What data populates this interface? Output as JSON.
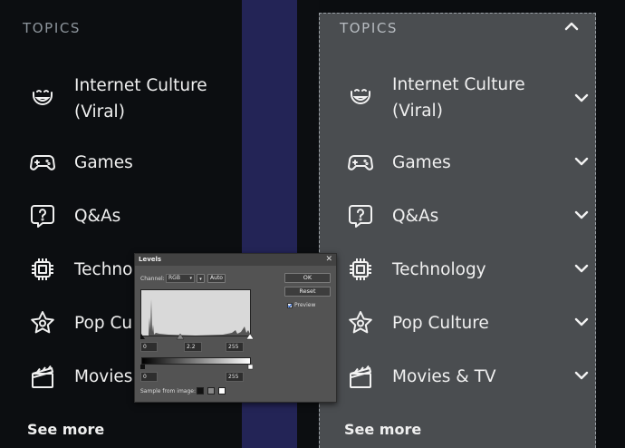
{
  "left_panel": {
    "title": "TOPICS",
    "items": [
      {
        "label_line1": "Internet Culture",
        "label_line2": "(Viral)",
        "icon": "smile-icon"
      },
      {
        "label": "Games",
        "icon": "gamepad-icon"
      },
      {
        "label": "Q&As",
        "icon": "question-bubble-icon"
      },
      {
        "label": "Techno",
        "icon": "chip-icon"
      },
      {
        "label": "Pop Cu",
        "icon": "star-icon"
      },
      {
        "label": "Movies",
        "icon": "clapperboard-icon"
      }
    ],
    "see_more": "See more"
  },
  "right_panel": {
    "title": "TOPICS",
    "items": [
      {
        "label_line1": "Internet Culture",
        "label_line2": "(Viral)",
        "icon": "smile-icon"
      },
      {
        "label": "Games",
        "icon": "gamepad-icon"
      },
      {
        "label": "Q&As",
        "icon": "question-bubble-icon"
      },
      {
        "label": "Technology",
        "icon": "chip-icon"
      },
      {
        "label": "Pop Culture",
        "icon": "star-icon"
      },
      {
        "label": "Movies & TV",
        "icon": "clapperboard-icon"
      }
    ],
    "see_more": "See more"
  },
  "levels_dialog": {
    "title": "Levels",
    "channel_label": "Channel:",
    "channel_value": "RGB",
    "auto_label": "Auto",
    "ok_label": "OK",
    "reset_label": "Reset",
    "preview_label": "Preview",
    "preview_checked": true,
    "input_black": "0",
    "input_gamma": "2.2",
    "input_white": "255",
    "output_black": "0",
    "output_white": "255",
    "sample_label": "Sample from image:"
  },
  "colors": {
    "panel_dark": "#0c0e11",
    "band": "#232456",
    "panel_highlight": "#4a4d50",
    "dialog_bg": "#535353"
  }
}
